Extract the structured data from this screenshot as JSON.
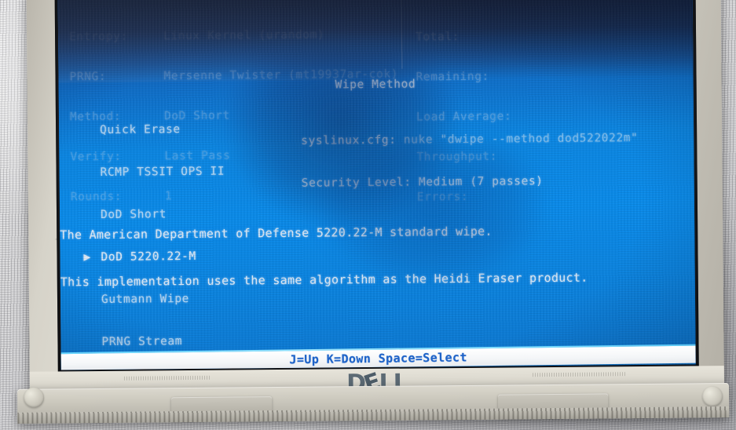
{
  "device": {
    "brand": "DELL",
    "brand_letters": [
      "D",
      "E",
      "LL"
    ]
  },
  "screen": {
    "options_panel": {
      "rows": [
        {
          "key": "Entropy:",
          "value": "Linux Kernel (urandom)"
        },
        {
          "key": "PRNG:",
          "value": "Mersenne Twister (mt19937ar-cok)"
        },
        {
          "key": "Method:",
          "value": "DoD Short"
        },
        {
          "key": "Verify:",
          "value": "Last Pass"
        },
        {
          "key": "Rounds:",
          "value": "1"
        }
      ]
    },
    "stats_panel": {
      "rows": [
        "Total:",
        "Remaining:",
        "Load Average:",
        "Throughput:",
        "Errors:"
      ]
    },
    "panel_title": "Wipe Method",
    "config_lines": [
      {
        "label": "syslinux.cfg: ",
        "value": "nuke \"dwipe --method dod522022m\""
      },
      {
        "label": "Security Level: ",
        "value": "Medium (7 passes)"
      }
    ],
    "menu": {
      "cursor_glyph": "▶",
      "selected_index": 3,
      "items": [
        "Quick Erase",
        "RCMP TSSIT OPS II",
        "DoD Short",
        "DoD 5220.22-M",
        "Gutmann Wipe",
        "PRNG Stream"
      ]
    },
    "description": [
      "The American Department of Defense 5220.22-M standard wipe.",
      "This implementation uses the same algorithm as the Heidi Eraser product."
    ],
    "statusbar": "J=Up  K=Down  Space=Select",
    "colors": {
      "screen_blue": "#0a8bea",
      "text": "#dceaf7",
      "statusbar_bg": "#ffffff",
      "statusbar_text": "#1e63c8",
      "rule": "#7fe0ff",
      "bezel": "#dedbd1"
    }
  }
}
